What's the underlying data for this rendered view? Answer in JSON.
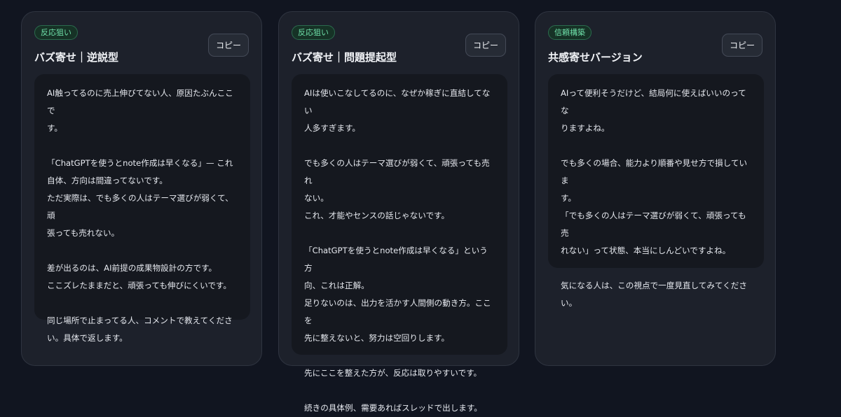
{
  "cards": [
    {
      "badge": "反応狙い",
      "title": "バズ寄せ｜逆説型",
      "copy_label": "コピー",
      "paragraphs": [
        "AI触ってるのに売上伸びてない人、原因たぶんここで\nす。",
        "「ChatGPTを使うとnote作成は早くなる」— これ\n自体、方向は間違ってないです。\nただ実際は、でも多くの人はテーマ選びが弱くて、頑\n張っても売れない。",
        "差が出るのは、AI前提の成果物設計の方です。\nここズレたままだと、頑張っても伸びにくいです。",
        "同じ場所で止まってる人、コメントで教えてくださ\nい。具体で返します。"
      ]
    },
    {
      "badge": "反応狙い",
      "title": "バズ寄せ｜問題提起型",
      "copy_label": "コピー",
      "paragraphs": [
        "AIは使いこなしてるのに、なぜか稼ぎに直結してない\n人多すぎます。",
        "でも多くの人はテーマ選びが弱くて、頑張っても売れ\nない。\nこれ、才能やセンスの話じゃないです。",
        "「ChatGPTを使うとnote作成は早くなる」という方\n向、これは正解。\n足りないのは、出力を活かす人間側の動き方。ここを\n先に整えないと、努力は空回りします。",
        "先にここを整えた方が、反応は取りやすいです。",
        "続きの具体例、需要あればスレッドで出します。"
      ]
    },
    {
      "badge": "信頼構築",
      "title": "共感寄せバージョン",
      "copy_label": "コピー",
      "paragraphs": [
        "AIって便利そうだけど、結局何に使えばいいのってな\nりますよね。",
        "でも多くの場合、能力より順番や見せ方で損していま\nす。\n「でも多くの人はテーマ選びが弱くて、頑張っても売\nれない」って状態、本当にしんどいですよね。",
        "気になる人は、この視点で一度見直してみてくださ\nい。"
      ]
    }
  ]
}
